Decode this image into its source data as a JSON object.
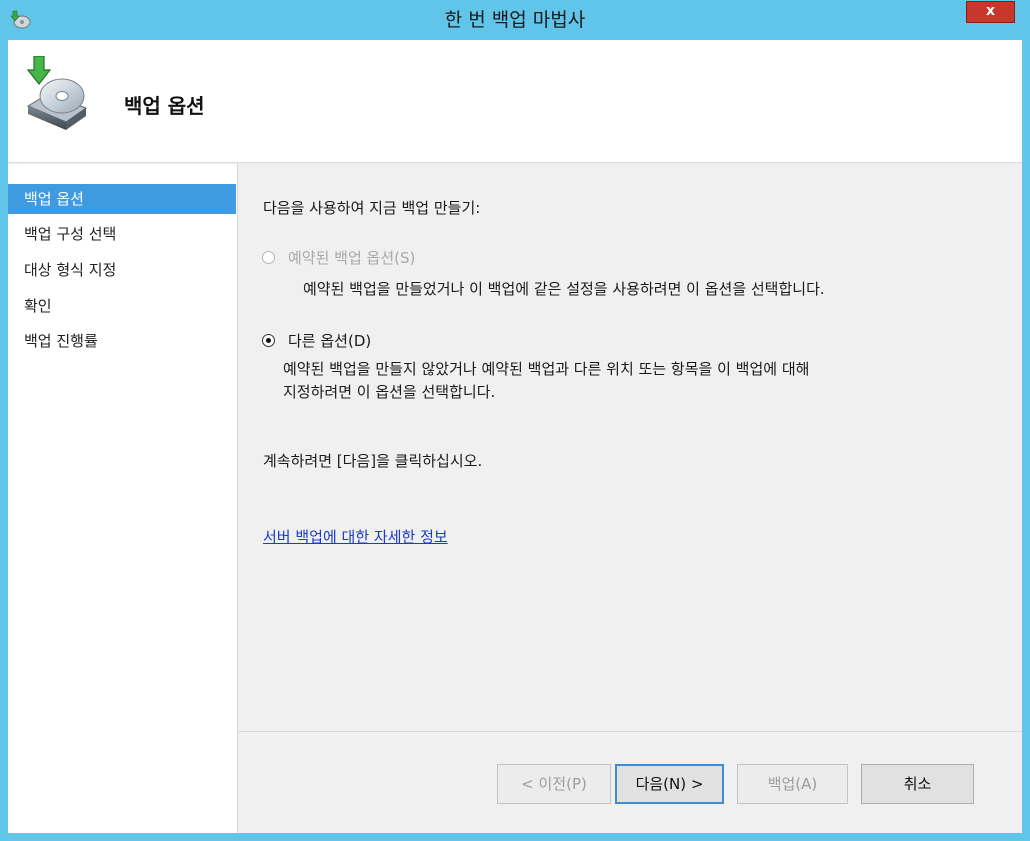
{
  "window": {
    "title": "한 번 백업 마법사",
    "close_label": "x"
  },
  "header": {
    "title": "백업 옵션"
  },
  "nav": {
    "items": [
      {
        "label": "백업 옵션",
        "active": true
      },
      {
        "label": "백업 구성 선택",
        "active": false
      },
      {
        "label": "대상 형식 지정",
        "active": false
      },
      {
        "label": "확인",
        "active": false
      },
      {
        "label": "백업 진행률",
        "active": false
      }
    ]
  },
  "main": {
    "intro": "다음을 사용하여 지금 백업 만들기:",
    "option_scheduled": {
      "label": "예약된 백업 옵션(S)",
      "description": "예약된 백업을 만들었거나 이 백업에 같은 설정을 사용하려면 이 옵션을 선택합니다.",
      "enabled": false,
      "selected": false
    },
    "option_different": {
      "label": "다른 옵션(D)",
      "description_line1": "예약된 백업을 만들지 않았거나 예약된 백업과 다른 위치 또는 항목을 이 백업에 대해",
      "description_line2": "지정하려면 이 옵션을 선택합니다.",
      "enabled": true,
      "selected": true
    },
    "continue_text": "계속하려면 [다음]을 클릭하십시오.",
    "help_link": "서버 백업에 대한 자세한 정보"
  },
  "buttons": {
    "previous": "< 이전(P)",
    "next": "다음(N) >",
    "backup": "백업(A)",
    "cancel": "취소"
  },
  "colors": {
    "title_bar": "#60c5e9",
    "selected_nav": "#3e9be2",
    "link": "#1a3bcc",
    "close_button": "#c7372c"
  }
}
